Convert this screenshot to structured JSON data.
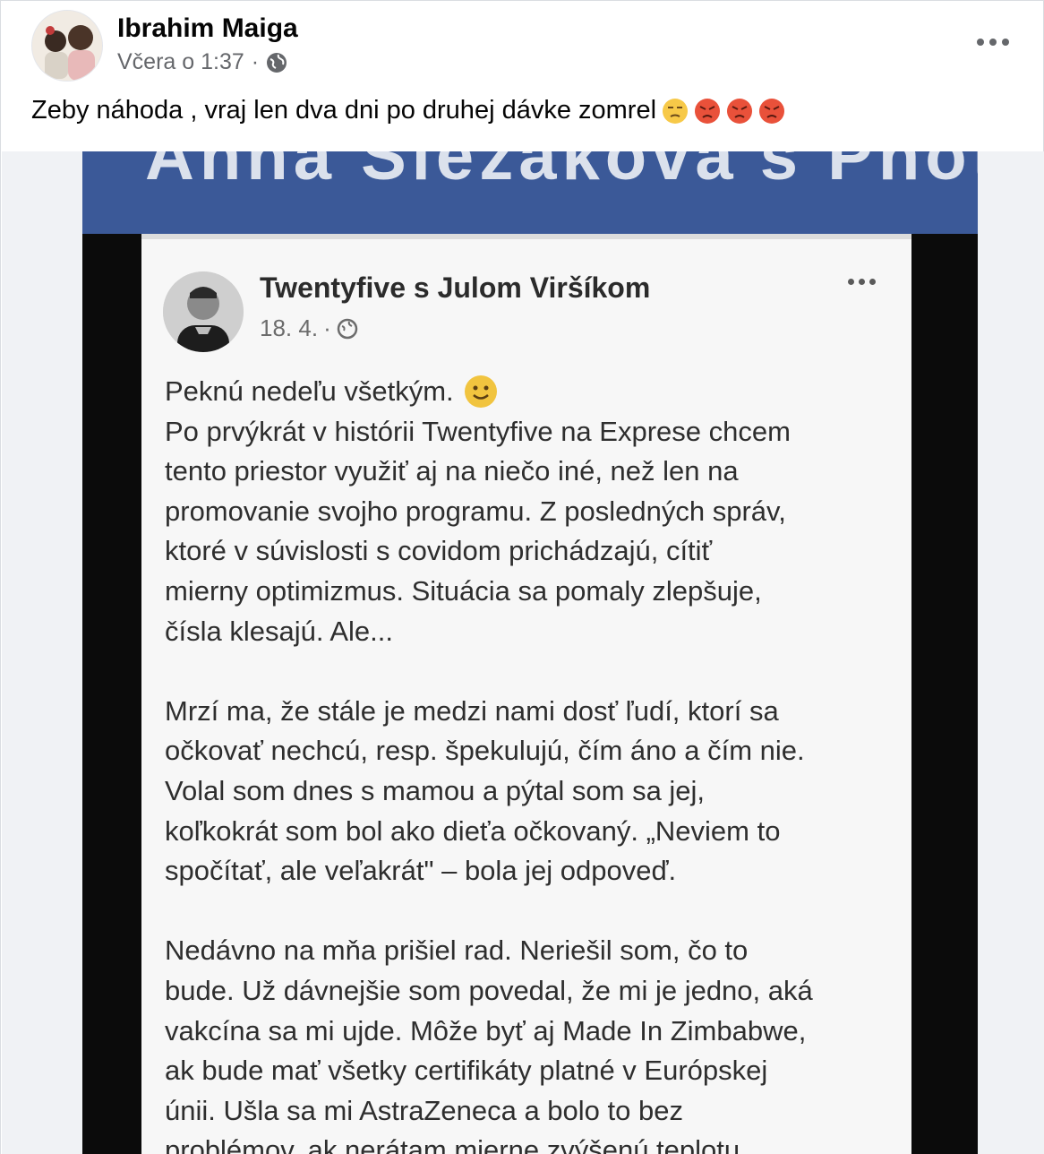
{
  "post": {
    "author": "Ibrahim Maiga",
    "timestamp": "Včera o 1:37",
    "separator": "·",
    "audience_icon": "globe-icon",
    "text": "Zeby náhoda , vraj len dva dni po druhej dávke zomrel",
    "emojis": [
      "unamused-face-emoji",
      "pouting-face-emoji",
      "pouting-face-emoji",
      "pouting-face-emoji"
    ]
  },
  "shared_image": {
    "banner_text": "Anna Slezakova's Photos",
    "banner_color": "#3b5998",
    "inner_post": {
      "author": "Twentyfive s Julom Viršíkom",
      "date": "18. 4.",
      "separator": "·",
      "audience_icon": "globe-icon",
      "lines": [
        "Peknú nedeľu všetkým.",
        "Po prvýkrát v histórii Twentyfive na Exprese chcem",
        "tento priestor využiť aj na niečo iné, než len na",
        "promovanie svojho programu. Z posledných správ,",
        "ktoré v súvislosti s covidom prichádzajú, cítiť",
        "mierny optimizmus. Situácia sa pomaly zlepšuje,",
        "čísla klesajú. Ale...",
        "Mrzí ma, že stále je medzi nami dosť ľudí, ktorí sa",
        "očkovať nechcú, resp. špekulujú, čím áno a čím nie.",
        "Volal som dnes s mamou a pýtal som sa jej,",
        "koľkokrát som bol ako dieťa očkovaný. „Neviem to",
        "spočítať, ale veľakrát\" – bola jej odpoveď.",
        "Nedávno na mňa prišiel rad. Neriešil som, čo to",
        "bude. Už dávnejšie som povedal, že mi je jedno, aká",
        "vakcína sa mi ujde. Môže byť aj Made In Zimbabwe,",
        "ak bude mať všetky certifikáty platné v Európskej",
        "únii. Ušla sa mi AstraZeneca a bolo to bez",
        "problémov, ak nerátam mierne zvýšenú teplotu"
      ]
    }
  }
}
